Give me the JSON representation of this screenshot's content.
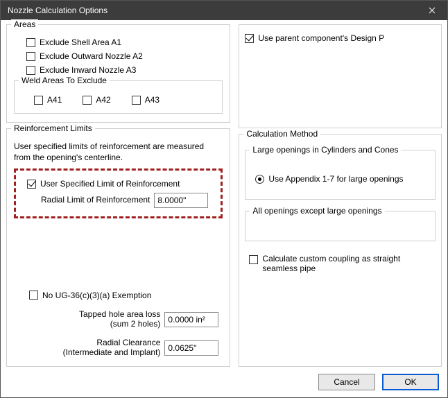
{
  "window": {
    "title": "Nozzle Calculation Options"
  },
  "areas": {
    "legend": "Areas",
    "exclude_a1": "Exclude Shell Area A1",
    "exclude_a2": "Exclude Outward Nozzle A2",
    "exclude_a3": "Exclude Inward Nozzle A3",
    "weld_legend": "Weld Areas To Exclude",
    "a41": "A41",
    "a42": "A42",
    "a43": "A43"
  },
  "reinforcement": {
    "legend": "Reinforcement Limits",
    "hint": "User specified limits of reinforcement are measured from the opening's centerline.",
    "user_specified": "User Specified Limit of Reinforcement",
    "radial_label": "Radial Limit of Reinforcement",
    "radial_value": "8.0000\""
  },
  "lower": {
    "no_ug36": "No UG-36(c)(3)(a) Exemption",
    "tapped_label1": "Tapped hole area loss",
    "tapped_label2": "(sum 2 holes)",
    "tapped_value": "0.0000 in²",
    "clearance_label1": "Radial Clearance",
    "clearance_label2": "(Intermediate and Implant)",
    "clearance_value": "0.0625\""
  },
  "right": {
    "use_parent": "Use parent component's Design P",
    "calc_method_legend": "Calculation Method",
    "large_legend": "Large openings in Cylinders and Cones",
    "use_appendix": "Use Appendix 1-7 for large openings",
    "all_legend": "All openings except large openings",
    "custom_coupling1": "Calculate custom coupling as straight",
    "custom_coupling2": "seamless pipe"
  },
  "buttons": {
    "cancel": "Cancel",
    "ok": "OK"
  }
}
